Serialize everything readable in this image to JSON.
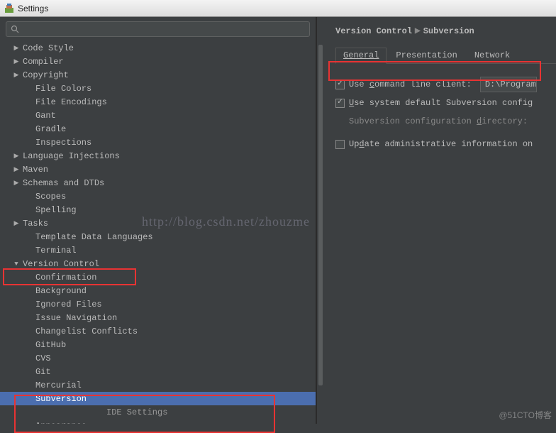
{
  "window": {
    "title": "Settings"
  },
  "search": {
    "placeholder": ""
  },
  "tree": {
    "items": [
      {
        "label": "Code Style",
        "arrow": "▶",
        "sub": false
      },
      {
        "label": "Compiler",
        "arrow": "▶",
        "sub": false
      },
      {
        "label": "Copyright",
        "arrow": "▶",
        "sub": false
      },
      {
        "label": "File Colors",
        "arrow": "",
        "sub": true
      },
      {
        "label": "File Encodings",
        "arrow": "",
        "sub": true
      },
      {
        "label": "Gant",
        "arrow": "",
        "sub": true
      },
      {
        "label": "Gradle",
        "arrow": "",
        "sub": true
      },
      {
        "label": "Inspections",
        "arrow": "",
        "sub": true
      },
      {
        "label": "Language Injections",
        "arrow": "▶",
        "sub": false
      },
      {
        "label": "Maven",
        "arrow": "▶",
        "sub": false
      },
      {
        "label": "Schemas and DTDs",
        "arrow": "▶",
        "sub": false
      },
      {
        "label": "Scopes",
        "arrow": "",
        "sub": true
      },
      {
        "label": "Spelling",
        "arrow": "",
        "sub": true
      },
      {
        "label": "Tasks",
        "arrow": "▶",
        "sub": false
      },
      {
        "label": "Template Data Languages",
        "arrow": "",
        "sub": true
      },
      {
        "label": "Terminal",
        "arrow": "",
        "sub": true
      },
      {
        "label": "Version Control",
        "arrow": "▼",
        "sub": false,
        "hl": true
      },
      {
        "label": "Confirmation",
        "arrow": "",
        "sub": true
      },
      {
        "label": "Background",
        "arrow": "",
        "sub": true
      },
      {
        "label": "Ignored Files",
        "arrow": "",
        "sub": true
      },
      {
        "label": "Issue Navigation",
        "arrow": "",
        "sub": true
      },
      {
        "label": "Changelist Conflicts",
        "arrow": "",
        "sub": true
      },
      {
        "label": "GitHub",
        "arrow": "",
        "sub": true
      },
      {
        "label": "CVS",
        "arrow": "",
        "sub": true
      },
      {
        "label": "Git",
        "arrow": "",
        "sub": true
      },
      {
        "label": "Mercurial",
        "arrow": "",
        "sub": true
      },
      {
        "label": "Subversion",
        "arrow": "",
        "sub": true,
        "selected": true
      }
    ],
    "section_header": "IDE Settings",
    "cutoff": "Annearance"
  },
  "breadcrumb": {
    "a": "Version Control",
    "b": "Subversion"
  },
  "tabs": {
    "t0": "General",
    "t1": "Presentation",
    "t2": "Network"
  },
  "opts": {
    "cli_label_pre": "Use ",
    "cli_label_u": "c",
    "cli_label_post": "ommand line client:",
    "cli_path": "D:\\Program",
    "sys_pre": "",
    "sys_u": "U",
    "sys_post": "se system default Subversion config",
    "dir_pre": "Subversion configuration ",
    "dir_u": "d",
    "dir_post": "irectory:",
    "upd_pre": "Up",
    "upd_u": "d",
    "upd_post": "ate administrative information on"
  },
  "watermark": "http://blog.csdn.net/zhouzme",
  "wm_br": "@51CTO博客"
}
